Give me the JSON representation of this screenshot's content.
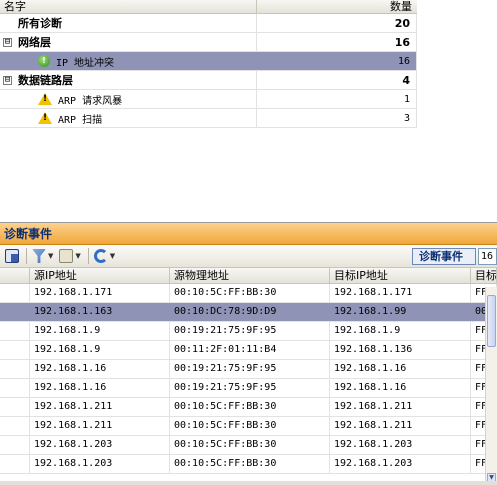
{
  "tree": {
    "header": {
      "name_col": "名字",
      "count_col": "数量"
    },
    "rows": [
      {
        "label": "所有诊断",
        "count": "20"
      },
      {
        "expander": "⊟",
        "label": "网络层",
        "count": "16"
      },
      {
        "label": "IP 地址冲突",
        "count": "16"
      },
      {
        "expander": "⊟",
        "label": "数据链路层",
        "count": "4"
      },
      {
        "label": "ARP 请求风暴",
        "count": "1"
      },
      {
        "label": "ARP 扫描",
        "count": "3"
      }
    ]
  },
  "events": {
    "title": "诊断事件",
    "toolbar": {
      "label": "诊断事件",
      "value": "16"
    },
    "columns": [
      "",
      "源IP地址",
      "源物理地址",
      "目标IP地址",
      "目标"
    ],
    "rows": [
      [
        "192.168.1.171",
        "00:10:5C:FF:BB:30",
        "192.168.1.171",
        "FF"
      ],
      [
        "192.168.1.163",
        "00:10:DC:78:9D:D9",
        "192.168.1.99",
        "00"
      ],
      [
        "192.168.1.9",
        "00:19:21:75:9F:95",
        "192.168.1.9",
        "FF"
      ],
      [
        "192.168.1.9",
        "00:11:2F:01:11:B4",
        "192.168.1.136",
        "FF"
      ],
      [
        "192.168.1.16",
        "00:19:21:75:9F:95",
        "192.168.1.16",
        "FF"
      ],
      [
        "192.168.1.16",
        "00:19:21:75:9F:95",
        "192.168.1.16",
        "FF"
      ],
      [
        "192.168.1.211",
        "00:10:5C:FF:BB:30",
        "192.168.1.211",
        "FF"
      ],
      [
        "192.168.1.211",
        "00:10:5C:FF:BB:30",
        "192.168.1.211",
        "FF"
      ],
      [
        "192.168.1.203",
        "00:10:5C:FF:BB:30",
        "192.168.1.203",
        "FF"
      ],
      [
        "192.168.1.203",
        "00:10:5C:FF:BB:30",
        "192.168.1.203",
        "FF"
      ]
    ]
  },
  "colors": {
    "selection": "#8f93b5",
    "panel_header": "#f1a63b",
    "title_text": "#0b2e73"
  },
  "icons": [
    "ok-status-icon",
    "warning-icon",
    "save-icon",
    "filter-icon",
    "export-icon",
    "refresh-icon"
  ]
}
